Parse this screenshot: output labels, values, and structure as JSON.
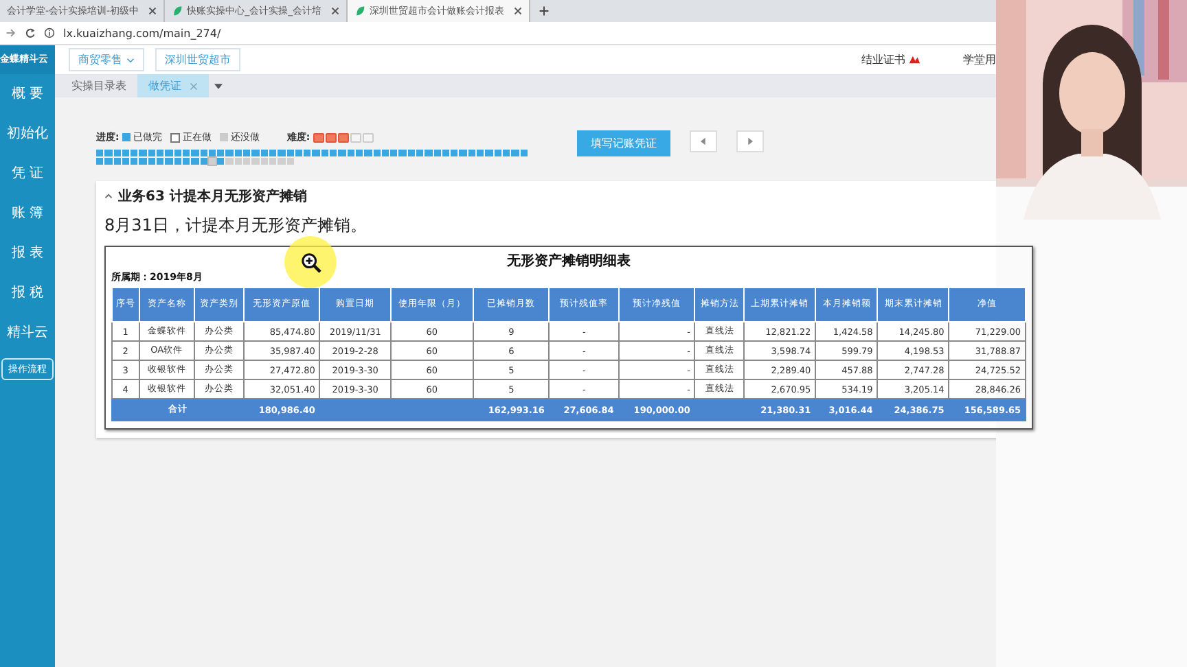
{
  "browser": {
    "tabs": [
      {
        "title": "会计学堂-会计实操培训-初级中",
        "selected": false,
        "icon": false
      },
      {
        "title": "快账实操中心_会计实操_会计培",
        "selected": false,
        "icon": true
      },
      {
        "title": "深圳世贸超市会计做账会计报表",
        "selected": true,
        "icon": true
      }
    ],
    "address": "lx.kuaizhang.com/main_274/"
  },
  "app": {
    "logo": "金蝶精斗云",
    "industry": "商贸零售",
    "company": "深圳世贸超市",
    "certificate": "结业证书",
    "user": "学堂用",
    "tabs": [
      {
        "label": "实操目录表",
        "selected": false,
        "closable": false
      },
      {
        "label": "做凭证",
        "selected": true,
        "closable": true
      }
    ]
  },
  "sidebar": {
    "items": [
      "概 要",
      "初始化",
      "凭 证",
      "账 簿",
      "报 表",
      "报 税",
      "精斗云"
    ],
    "flow_button": "操作流程"
  },
  "progress": {
    "label": "进度:",
    "legend": [
      {
        "label": "已做完",
        "kind": "done"
      },
      {
        "label": "正在做",
        "kind": "current"
      },
      {
        "label": "还没做",
        "kind": "todo"
      }
    ],
    "difficulty_label": "难度:",
    "stars": 3,
    "cells": [
      {
        "done": true,
        "current": false
      },
      {
        "done": true,
        "current": false
      },
      {
        "done": true,
        "current": false
      },
      {
        "done": true,
        "current": false
      },
      {
        "done": true,
        "current": false
      },
      {
        "done": true,
        "current": false
      },
      {
        "done": true,
        "current": false
      },
      {
        "done": true,
        "current": false
      },
      {
        "done": true,
        "current": false
      },
      {
        "done": true,
        "current": false
      },
      {
        "done": true,
        "current": false
      },
      {
        "done": true,
        "current": false
      },
      {
        "done": true,
        "current": false
      },
      {
        "done": true,
        "current": false
      },
      {
        "done": true,
        "current": false
      },
      {
        "done": true,
        "current": false
      },
      {
        "done": true,
        "current": false
      },
      {
        "done": true,
        "current": false
      },
      {
        "done": true,
        "current": false
      },
      {
        "done": true,
        "current": false
      },
      {
        "done": true,
        "current": false
      },
      {
        "done": true,
        "current": false
      },
      {
        "done": true,
        "current": false
      },
      {
        "done": true,
        "current": false
      },
      {
        "done": true,
        "current": false
      },
      {
        "done": true,
        "current": false
      },
      {
        "done": true,
        "current": false
      },
      {
        "done": true,
        "current": false
      },
      {
        "done": true,
        "current": false
      },
      {
        "done": true,
        "current": false
      },
      {
        "done": true,
        "current": false
      },
      {
        "done": true,
        "current": false
      },
      {
        "done": true,
        "current": false
      },
      {
        "done": true,
        "current": false
      },
      {
        "done": true,
        "current": false
      },
      {
        "done": true,
        "current": false
      },
      {
        "done": true,
        "current": false
      },
      {
        "done": true,
        "current": false
      },
      {
        "done": true,
        "current": false
      },
      {
        "done": true,
        "current": false
      },
      {
        "done": true,
        "current": false
      },
      {
        "done": true,
        "current": false
      },
      {
        "done": true,
        "current": false
      },
      {
        "done": true,
        "current": false
      },
      {
        "done": true,
        "current": false
      },
      {
        "done": true,
        "current": false
      },
      {
        "done": true,
        "current": false
      },
      {
        "done": true,
        "current": false
      },
      {
        "done": true,
        "current": false
      },
      {
        "done": true,
        "current": false
      },
      {
        "done": true,
        "current": false
      },
      {
        "done": true,
        "current": false
      },
      {
        "done": true,
        "current": false
      },
      {
        "done": true,
        "current": false
      },
      {
        "done": true,
        "current": false
      },
      {
        "done": true,
        "current": false
      },
      {
        "done": true,
        "current": false
      },
      {
        "done": true,
        "current": false
      },
      {
        "done": true,
        "current": false
      },
      {
        "done": true,
        "current": false
      },
      {
        "done": true,
        "current": false
      },
      {
        "done": true,
        "current": false
      },
      {
        "done": true,
        "current": false
      },
      {
        "done": false,
        "current": true
      },
      {
        "done": true,
        "current": false
      },
      {
        "done": false,
        "current": false
      },
      {
        "done": false,
        "current": false
      },
      {
        "done": false,
        "current": false
      },
      {
        "done": false,
        "current": false
      },
      {
        "done": false,
        "current": false
      },
      {
        "done": false,
        "current": false
      },
      {
        "done": false,
        "current": false
      },
      {
        "done": false,
        "current": false
      }
    ]
  },
  "actions": {
    "primary": "填写记账凭证"
  },
  "task": {
    "title": "业务63 计提本月无形资产摊销",
    "sentence": "8月31日，计提本月无形资产摊销。",
    "table": {
      "title": "无形资产摊销明细表",
      "period": "所属期：2019年8月",
      "columns": [
        "序号",
        "资产名称",
        "资产类别",
        "无形资产原值",
        "购置日期",
        "使用年限（月）",
        "已摊销月数",
        "预计残值率",
        "预计净残值",
        "摊销方法",
        "上期累计摊销",
        "本月摊销额",
        "期末累计摊销",
        "净值"
      ],
      "rows": [
        [
          "1",
          "金蝶软件",
          "办公类",
          "85,474.80",
          "2019/11/31",
          "60",
          "9",
          "-",
          "-",
          "直线法",
          "12,821.22",
          "1,424.58",
          "14,245.80",
          "71,229.00"
        ],
        [
          "2",
          "OA软件",
          "办公类",
          "35,987.40",
          "2019-2-28",
          "60",
          "6",
          "-",
          "-",
          "直线法",
          "3,598.74",
          "599.79",
          "4,198.53",
          "31,788.87"
        ],
        [
          "3",
          "收银软件",
          "办公类",
          "27,472.80",
          "2019-3-30",
          "60",
          "5",
          "-",
          "-",
          "直线法",
          "2,289.40",
          "457.88",
          "2,747.28",
          "24,725.52"
        ],
        [
          "4",
          "收银软件",
          "办公类",
          "32,051.40",
          "2019-3-30",
          "60",
          "5",
          "-",
          "-",
          "直线法",
          "2,670.95",
          "534.19",
          "3,205.14",
          "28,846.26"
        ]
      ],
      "total": {
        "label": "合计",
        "cells": [
          {
            "blank": false,
            "value": "180,986.40"
          },
          {
            "blank": true
          },
          {
            "blank": true
          },
          {
            "blank": false,
            "value": "162,993.16"
          },
          {
            "blank": false,
            "value": "27,606.84"
          },
          {
            "blank": false,
            "value": "190,000.00"
          },
          {
            "blank": true
          },
          {
            "blank": false,
            "value": "21,380.31"
          },
          {
            "blank": false,
            "value": "3,016.44"
          },
          {
            "blank": false,
            "value": "24,386.75"
          },
          {
            "blank": false,
            "value": "156,589.65"
          }
        ]
      }
    }
  }
}
